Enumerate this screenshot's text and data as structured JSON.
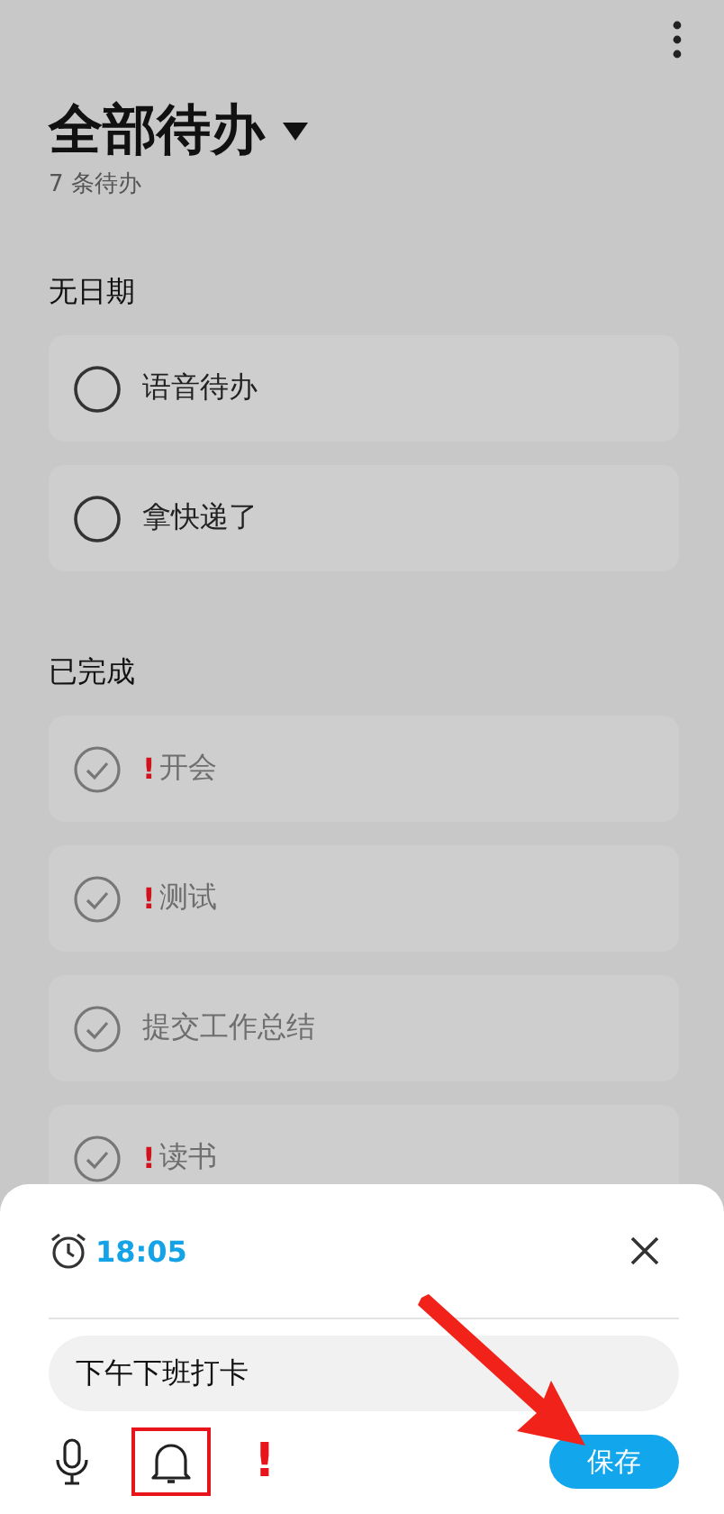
{
  "header": {
    "title": "全部待办",
    "subtitle": "7 条待办"
  },
  "sections": [
    {
      "title": "无日期",
      "items": [
        {
          "text": "语音待办",
          "done": false
        },
        {
          "text": "拿快递了",
          "done": false
        }
      ]
    },
    {
      "title": "已完成",
      "items": [
        {
          "text": "开会",
          "done": true,
          "mark": "!"
        },
        {
          "text": "测试",
          "done": true,
          "mark": "!"
        },
        {
          "text": "提交工作总结",
          "done": true
        },
        {
          "text": "读书",
          "done": true,
          "mark": "!"
        }
      ]
    }
  ],
  "sheet": {
    "time": "18:05",
    "input": {
      "value": "下午下班打卡"
    },
    "priority_button": "!",
    "save_button": "保存",
    "reminder_highlighted": true
  }
}
